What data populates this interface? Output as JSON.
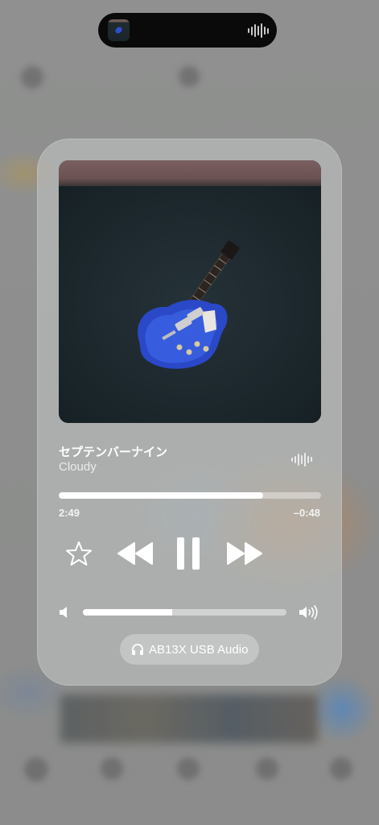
{
  "now_playing": {
    "title": "セプテンバーナイン",
    "artist": "Cloudy",
    "elapsed": "2:49",
    "remaining": "–0:48",
    "progress_fraction": 0.78,
    "is_playing": true
  },
  "volume": {
    "level_fraction": 0.44
  },
  "audio_route": {
    "label": "AB13X USB Audio",
    "icon": "headphones-icon"
  },
  "controls": {
    "favorite_icon": "star-icon",
    "previous_icon": "rewind-icon",
    "play_pause_icon": "pause-icon",
    "next_icon": "fast-forward-icon"
  },
  "dynamic_island": {
    "activity_icon": "waveform-icon"
  },
  "colors": {
    "card_background": "#b9bbba",
    "accent_text": "#ffffff",
    "island_background": "#0a0a0a"
  }
}
